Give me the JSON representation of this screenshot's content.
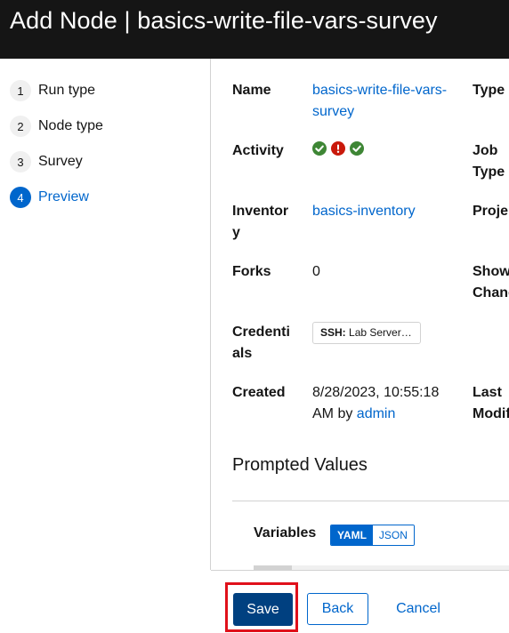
{
  "header": {
    "title": "Add Node | basics-write-file-vars-survey"
  },
  "wizard": {
    "steps": [
      {
        "number": "1",
        "label": "Run type"
      },
      {
        "number": "2",
        "label": "Node type"
      },
      {
        "number": "3",
        "label": "Survey"
      },
      {
        "number": "4",
        "label": "Preview"
      }
    ],
    "current_step": "4"
  },
  "details": {
    "name_label": "Name",
    "name_value_line1": "basics-write-file-vars-",
    "name_value_line2": "survey",
    "type_label": "Type",
    "activity_label": "Activity",
    "activity_statuses": [
      "success",
      "failed",
      "success"
    ],
    "job_type_label_line1": "Job",
    "job_type_label_line2": "Type",
    "inventory_label_line1": "Inventor",
    "inventory_label_line2": "y",
    "inventory_value": "basics-inventory",
    "project_label": "Proje",
    "forks_label": "Forks",
    "forks_value": "0",
    "show_changes_label_line1": "Show",
    "show_changes_label_line2": "Chanc",
    "credentials_label_line1": "Credenti",
    "credentials_label_line2": "als",
    "credential_chip_type": "SSH:",
    "credential_chip_name": "Lab Server…",
    "created_label": "Created",
    "created_value_line1": "8/28/2023, 10:55:18",
    "created_value_line2_prefix": "AM by",
    "created_by": "admin",
    "last_modified_label_line1": "Last",
    "last_modified_label_line2": "Modif"
  },
  "prompted": {
    "title": "Prompted Values",
    "variables_label": "Variables",
    "yaml_label": "YAML",
    "json_label": "JSON",
    "active_format": "YAML"
  },
  "footer": {
    "save_label": "Save",
    "back_label": "Back",
    "cancel_label": "Cancel"
  },
  "colors": {
    "accent": "#0066cc",
    "primary_button": "#004080",
    "success": "#3e8635",
    "danger": "#c9190b",
    "highlight": "#e0101a",
    "header_bg": "#151515"
  }
}
